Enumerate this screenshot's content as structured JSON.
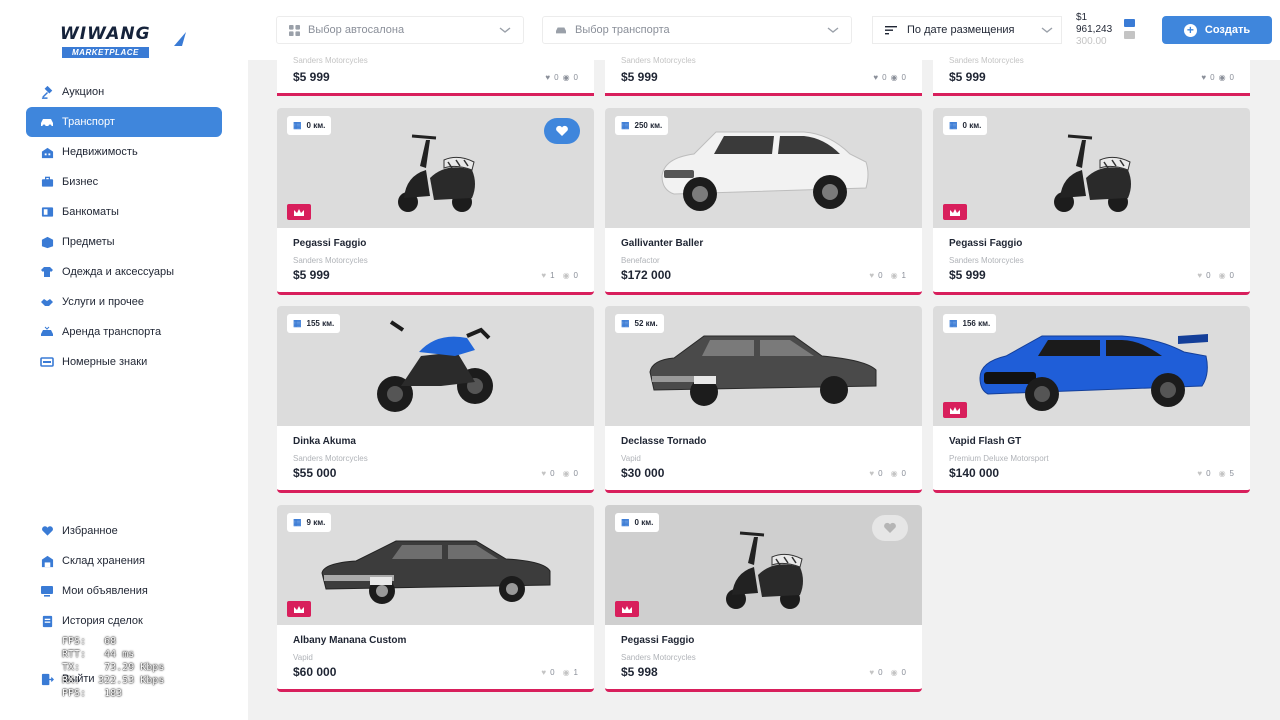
{
  "brand": {
    "name": "WIWANG",
    "sub": "MARKETPLACE"
  },
  "sidebar": {
    "items": [
      {
        "label": "Аукцион",
        "icon": "auction-icon"
      },
      {
        "label": "Транспорт",
        "icon": "car-icon",
        "active": true
      },
      {
        "label": "Недвижимость",
        "icon": "building-icon"
      },
      {
        "label": "Бизнес",
        "icon": "briefcase-icon"
      },
      {
        "label": "Банкоматы",
        "icon": "atm-icon"
      },
      {
        "label": "Предметы",
        "icon": "box-icon"
      },
      {
        "label": "Одежда и аксессуары",
        "icon": "clothes-icon"
      },
      {
        "label": "Услуги и прочее",
        "icon": "handshake-icon"
      },
      {
        "label": "Аренда транспорта",
        "icon": "rent-car-icon"
      },
      {
        "label": "Номерные знаки",
        "icon": "plate-icon"
      }
    ],
    "bottom_items": [
      {
        "label": "Избранное",
        "icon": "heart-icon"
      },
      {
        "label": "Склад хранения",
        "icon": "warehouse-icon"
      },
      {
        "label": "Мои объявления",
        "icon": "ads-icon"
      },
      {
        "label": "История сделок",
        "icon": "history-icon"
      },
      {
        "label": "Выйти",
        "icon": "logout-icon"
      }
    ]
  },
  "overlay_stats": {
    "fps": "FPS:   68",
    "rtt": "RTT:   44 ms",
    "tx": "TX:    73.29 Kbps",
    "rx": "RX:   322.53 Kbps",
    "pps": "PPS:   183"
  },
  "topbar": {
    "dealer_placeholder": "Выбор автосалона",
    "vehicle_placeholder": "Выбор транспорта",
    "sort_label": "По дате размещения",
    "balance_line1": "$1",
    "balance_line2": "961,243",
    "balance_line3": "300.00",
    "create_label": "Создать"
  },
  "colors": {
    "accent": "#3f86dc",
    "highlight": "#d81f5c",
    "background": "#f1f1f1"
  },
  "top_partial": [
    {
      "brand": "Sanders Motorcycles",
      "price": "$5 999",
      "likes": "0",
      "views": "0"
    },
    {
      "brand": "Sanders Motorcycles",
      "price": "$5 999",
      "likes": "0",
      "views": "0"
    },
    {
      "brand": "Sanders Motorcycles",
      "price": "$5 999",
      "likes": "0",
      "views": "0"
    }
  ],
  "listings": [
    {
      "km": "0 км.",
      "name": "Pegassi Faggio",
      "brand": "Sanders Motorcycles",
      "price": "$5 999",
      "likes": "1",
      "views": "0",
      "vehicle": "scooter",
      "premium": true,
      "favorite": true
    },
    {
      "km": "250 км.",
      "name": "Gallivanter Baller",
      "brand": "Benefactor",
      "price": "$172 000",
      "likes": "0",
      "views": "1",
      "vehicle": "suv",
      "premium": false
    },
    {
      "km": "0 км.",
      "name": "Pegassi Faggio",
      "brand": "Sanders Motorcycles",
      "price": "$5 999",
      "likes": "0",
      "views": "0",
      "vehicle": "scooter",
      "premium": true
    },
    {
      "km": "155 км.",
      "name": "Dinka Akuma",
      "brand": "Sanders Motorcycles",
      "price": "$55 000",
      "likes": "0",
      "views": "0",
      "vehicle": "motorbike",
      "premium": false
    },
    {
      "km": "52 км.",
      "name": "Declasse Tornado",
      "brand": "Vapid",
      "price": "$30 000",
      "likes": "0",
      "views": "0",
      "vehicle": "classic",
      "premium": false
    },
    {
      "km": "156 км.",
      "name": "Vapid Flash GT",
      "brand": "Premium Deluxe Motorsport",
      "price": "$140 000",
      "likes": "0",
      "views": "5",
      "vehicle": "sports",
      "premium": true
    },
    {
      "km": "9 км.",
      "name": "Albany Manana Custom",
      "brand": "Vapid",
      "price": "$60 000",
      "likes": "0",
      "views": "1",
      "vehicle": "lowrider",
      "premium": true
    },
    {
      "km": "0 км.",
      "name": "Pegassi Faggio",
      "brand": "Sanders Motorcycles",
      "price": "$5 998",
      "likes": "0",
      "views": "0",
      "vehicle": "scooter",
      "premium": true,
      "favorite_light": true
    }
  ]
}
